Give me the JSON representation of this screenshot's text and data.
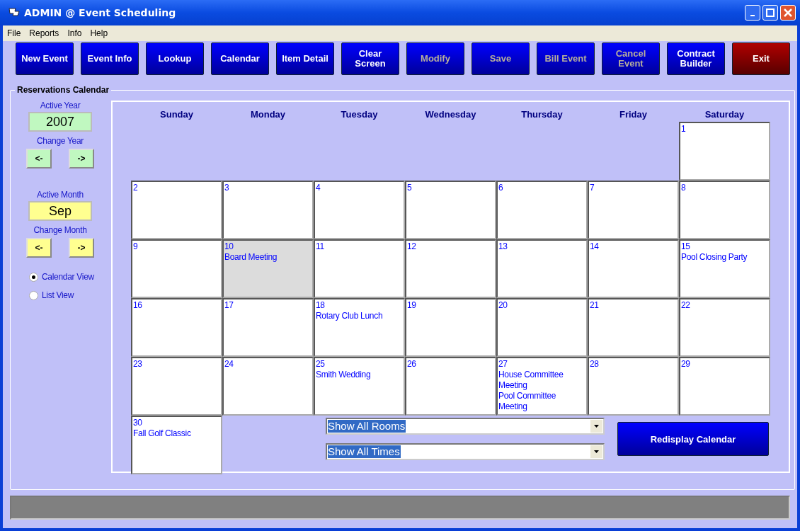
{
  "window": {
    "title": "ADMIN @ Event Scheduling"
  },
  "menu": [
    "File",
    "Reports",
    "Info",
    "Help"
  ],
  "toolbar": [
    {
      "label": "New Event",
      "kind": "normal",
      "disabled": false
    },
    {
      "label": "Event Info",
      "kind": "normal",
      "disabled": false
    },
    {
      "label": "Lookup",
      "kind": "normal",
      "disabled": false
    },
    {
      "label": "Calendar",
      "kind": "normal",
      "disabled": false
    },
    {
      "label": "Item Detail",
      "kind": "normal",
      "disabled": false
    },
    {
      "label": "Clear Screen",
      "kind": "normal",
      "disabled": false
    },
    {
      "label": "Modify",
      "kind": "normal",
      "disabled": true
    },
    {
      "label": "Save",
      "kind": "normal",
      "disabled": true
    },
    {
      "label": "Bill Event",
      "kind": "normal",
      "disabled": true
    },
    {
      "label": "Cancel Event",
      "kind": "normal",
      "disabled": true
    },
    {
      "label": "Contract Builder",
      "kind": "normal",
      "disabled": false
    },
    {
      "label": "Exit",
      "kind": "exit",
      "disabled": false
    }
  ],
  "group_title": "Reservations Calendar",
  "year": {
    "label": "Active Year",
    "value": "2007",
    "change_label": "Change Year",
    "prev": "<-",
    "next": "->"
  },
  "month": {
    "label": "Active Month",
    "value": "Sep",
    "change_label": "Change Month",
    "prev": "<-",
    "next": "->"
  },
  "views": [
    {
      "label": "Calendar View",
      "selected": true
    },
    {
      "label": "List View",
      "selected": false
    }
  ],
  "calendar": {
    "weekdays": [
      "Sunday",
      "Monday",
      "Tuesday",
      "Wednesday",
      "Thursday",
      "Friday",
      "Saturday"
    ],
    "weeks": [
      [
        {
          "kind": "blank"
        },
        {
          "kind": "blank"
        },
        {
          "kind": "blank"
        },
        {
          "kind": "blank"
        },
        {
          "kind": "blank"
        },
        {
          "kind": "blank"
        },
        {
          "kind": "day",
          "day": "1",
          "selected": false
        }
      ],
      [
        {
          "kind": "day",
          "day": "2",
          "selected": false
        },
        {
          "kind": "day",
          "day": "3",
          "selected": false
        },
        {
          "kind": "day",
          "day": "4",
          "selected": false
        },
        {
          "kind": "day",
          "day": "5",
          "selected": false
        },
        {
          "kind": "day",
          "day": "6",
          "selected": false
        },
        {
          "kind": "day",
          "day": "7",
          "selected": false
        },
        {
          "kind": "day",
          "day": "8",
          "selected": false
        }
      ],
      [
        {
          "kind": "day",
          "day": "9",
          "selected": false
        },
        {
          "kind": "day",
          "day": "10",
          "selected": true,
          "events": [
            "Board Meeting"
          ]
        },
        {
          "kind": "day",
          "day": "11",
          "selected": false
        },
        {
          "kind": "day",
          "day": "12",
          "selected": false
        },
        {
          "kind": "day",
          "day": "13",
          "selected": false
        },
        {
          "kind": "day",
          "day": "14",
          "selected": false
        },
        {
          "kind": "day",
          "day": "15",
          "selected": false,
          "events": [
            "Pool Closing Party"
          ]
        }
      ],
      [
        {
          "kind": "day",
          "day": "16",
          "selected": false
        },
        {
          "kind": "day",
          "day": "17",
          "selected": false
        },
        {
          "kind": "day",
          "day": "18",
          "selected": false,
          "events": [
            "Rotary Club Lunch"
          ]
        },
        {
          "kind": "day",
          "day": "19",
          "selected": false
        },
        {
          "kind": "day",
          "day": "20",
          "selected": false
        },
        {
          "kind": "day",
          "day": "21",
          "selected": false
        },
        {
          "kind": "day",
          "day": "22",
          "selected": false
        }
      ],
      [
        {
          "kind": "day",
          "day": "23",
          "selected": false
        },
        {
          "kind": "day",
          "day": "24",
          "selected": false
        },
        {
          "kind": "day",
          "day": "25",
          "selected": false,
          "events": [
            "Smith Wedding"
          ]
        },
        {
          "kind": "day",
          "day": "26",
          "selected": false
        },
        {
          "kind": "day",
          "day": "27",
          "selected": false,
          "events": [
            "House Committee Meeting",
            "Pool Committee Meeting"
          ]
        },
        {
          "kind": "day",
          "day": "28",
          "selected": false
        },
        {
          "kind": "day",
          "day": "29",
          "selected": false
        }
      ],
      [
        {
          "kind": "day",
          "day": "30",
          "selected": false,
          "events": [
            "Fall Golf Classic"
          ]
        }
      ]
    ]
  },
  "filters": [
    {
      "value": "Show All Rooms"
    },
    {
      "value": "Show All Times"
    }
  ],
  "redisplay_button": "Redisplay Calendar"
}
